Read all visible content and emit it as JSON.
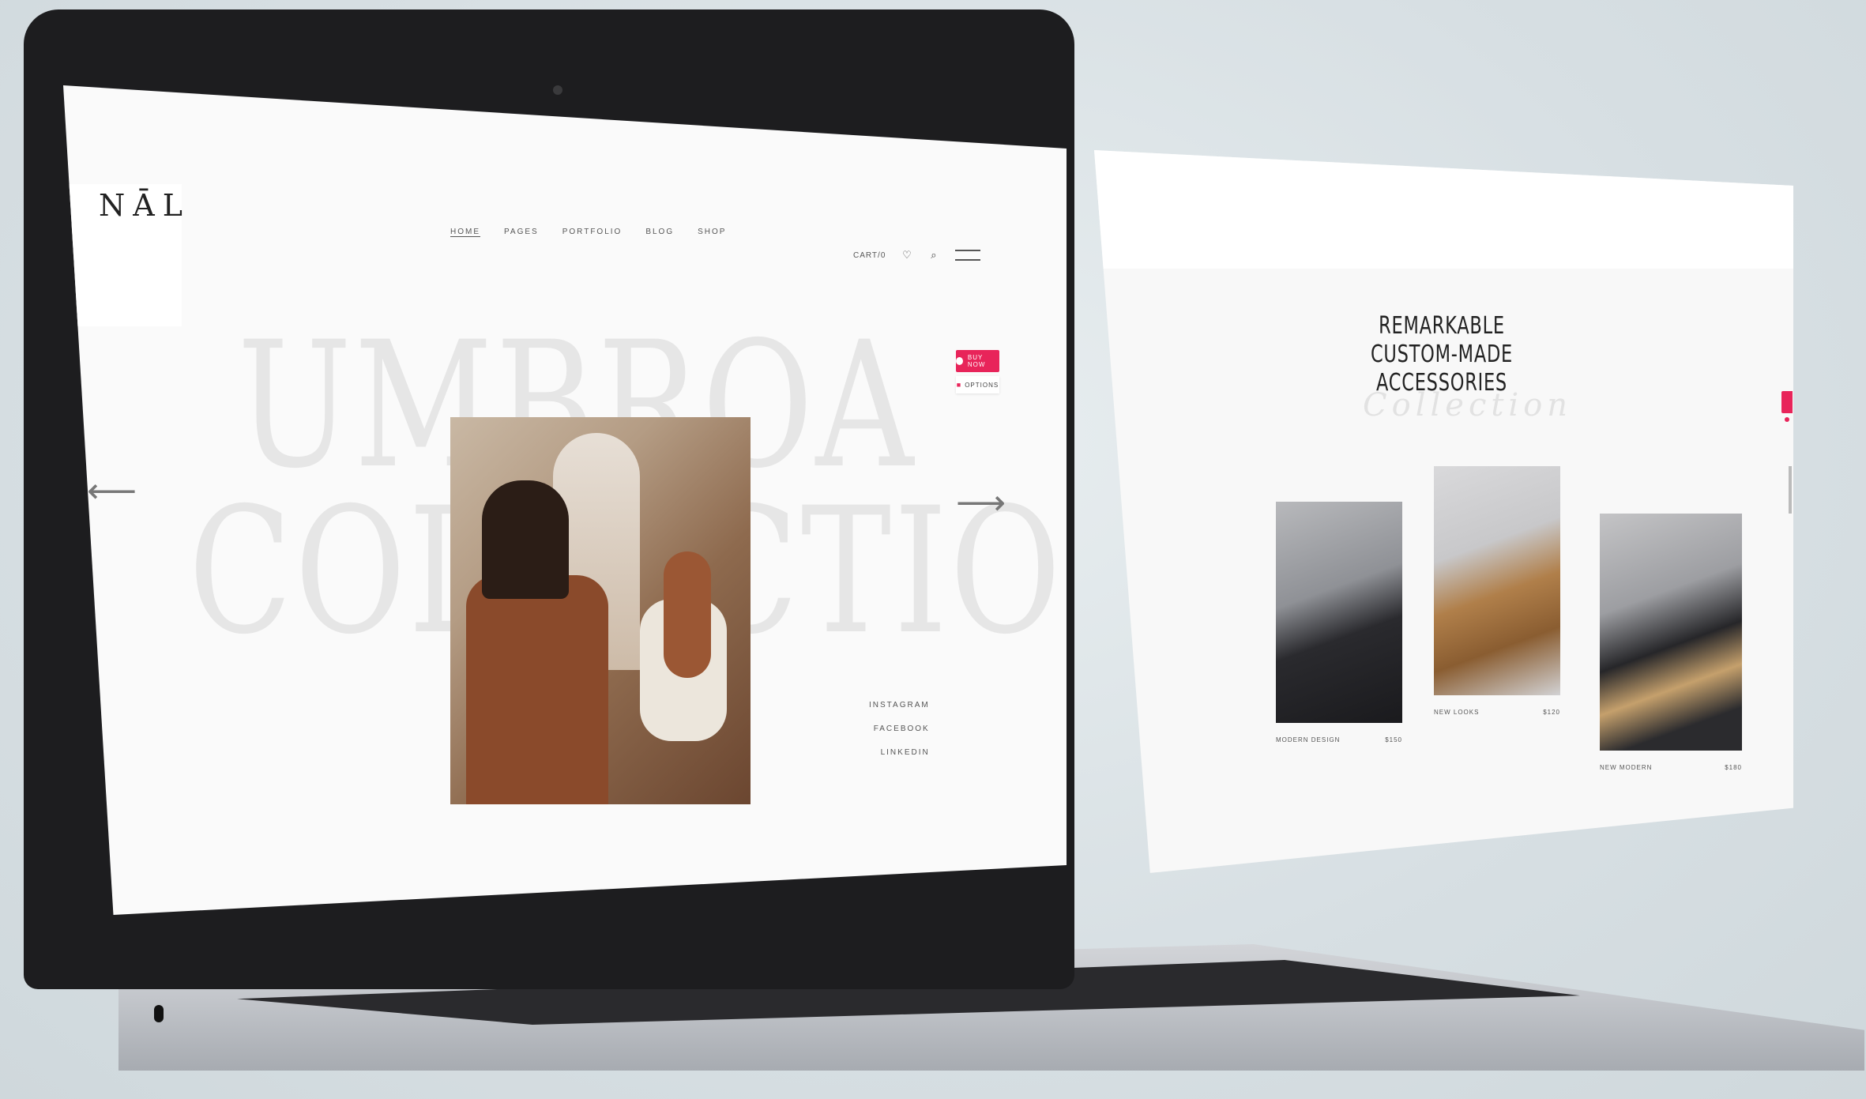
{
  "laptop_site": {
    "logo": "NĀL",
    "nav": [
      "HOME",
      "PAGES",
      "PORTFOLIO",
      "BLOG",
      "SHOP"
    ],
    "cart_label": "CART/0",
    "hero_title_line1": "UMBROA",
    "hero_title_line2": "COLLECTION",
    "socials": [
      "INSTAGRAM",
      "FACEBOOK",
      "LINKEDIN"
    ],
    "buy_label": "BUY NOW",
    "options_label": "OPTIONS",
    "prev_arrow": "⟵",
    "next_arrow": "⟶"
  },
  "panel_site": {
    "title_lines": [
      "REMARKABLE",
      "CUSTOM-MADE",
      "ACCESSORIES"
    ],
    "script_word": "Collection",
    "products": [
      {
        "name": "MODERN DESIGN",
        "price": "$150"
      },
      {
        "name": "NEW LOOKS",
        "price": "$120"
      },
      {
        "name": "NEW MODERN",
        "price": "$180"
      }
    ]
  },
  "colors": {
    "accent": "#e8245a",
    "bezel": "#1d1d1f",
    "background": "#d7dfe3"
  },
  "icons": [
    "heart-icon",
    "search-icon",
    "menu-icon",
    "arrow-left-icon",
    "arrow-right-icon",
    "cart-icon"
  ]
}
